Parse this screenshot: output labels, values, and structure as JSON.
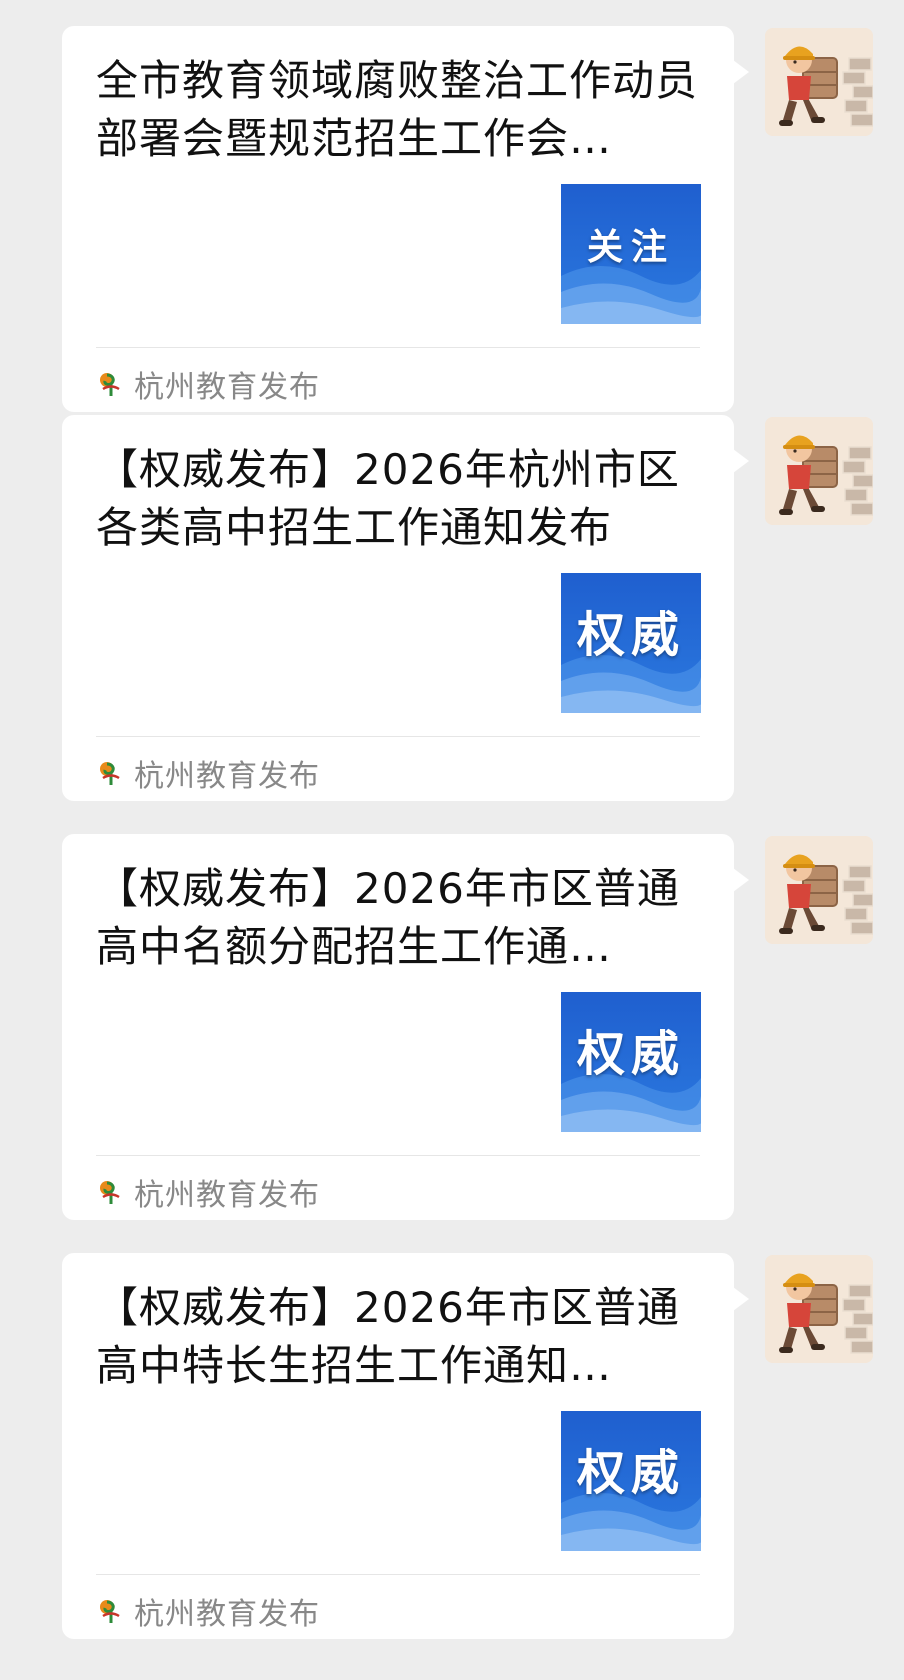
{
  "messages": [
    {
      "title": "全市教育领域腐败整治工作动员部署会暨规范招生工作会…",
      "thumbnail_text": "关注",
      "source_name": "杭州教育发布",
      "source_icon": "edu-logo-icon",
      "avatar_icon": "worker-carrying-bricks-avatar"
    },
    {
      "title": "【权威发布】2026年杭州市区各类高中招生工作通知发布",
      "thumbnail_text": "权威",
      "source_name": "杭州教育发布",
      "source_icon": "edu-logo-icon",
      "avatar_icon": "worker-carrying-bricks-avatar"
    },
    {
      "title": "【权威发布】2026年市区普通高中名额分配招生工作通…",
      "thumbnail_text": "权威",
      "source_name": "杭州教育发布",
      "source_icon": "edu-logo-icon",
      "avatar_icon": "worker-carrying-bricks-avatar"
    },
    {
      "title": "【权威发布】2026年市区普通高中特长生招生工作通知…",
      "thumbnail_text": "权威",
      "source_name": "杭州教育发布",
      "source_icon": "edu-logo-icon",
      "avatar_icon": "worker-carrying-bricks-avatar"
    }
  ],
  "colors": {
    "background": "#ededed",
    "bubble": "#ffffff",
    "thumbnail_blue": "#1e5ec7",
    "source_text": "#888888"
  }
}
